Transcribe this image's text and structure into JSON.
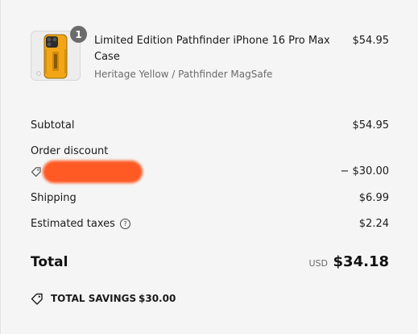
{
  "line_item": {
    "quantity": "1",
    "title": "Limited Edition Pathfinder iPhone 16 Pro Max Case",
    "variant": "Heritage Yellow / Pathfinder MagSafe",
    "price": "$54.95"
  },
  "summary": {
    "subtotal_label": "Subtotal",
    "subtotal_value": "$54.95",
    "discount_label": "Order discount",
    "discount_value": "− $30.00",
    "shipping_label": "Shipping",
    "shipping_value": "$6.99",
    "taxes_label": "Estimated taxes",
    "taxes_info_glyph": "?",
    "taxes_value": "$2.24"
  },
  "total": {
    "label": "Total",
    "currency": "USD",
    "amount": "$34.18"
  },
  "savings": {
    "label": "TOTAL SAVINGS",
    "amount": "$30.00"
  },
  "colors": {
    "background": "#f5f5f5",
    "redaction": "#ff5a24",
    "product_yellow": "#f2a516",
    "badge": "#6b6b6b",
    "muted_text": "#6b6b6b"
  },
  "icons": {
    "discount_code": "tag-icon",
    "taxes_info": "info-icon",
    "savings": "tag-icon"
  }
}
